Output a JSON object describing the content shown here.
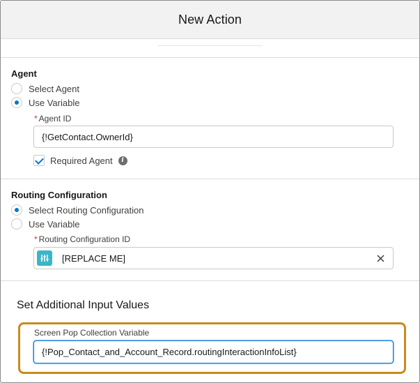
{
  "header": {
    "title": "New Action"
  },
  "agent": {
    "section_title": "Agent",
    "options": [
      {
        "label": "Select Agent",
        "checked": false
      },
      {
        "label": "Use Variable",
        "checked": true
      }
    ],
    "agent_id": {
      "required_marker": "*",
      "label": "Agent ID",
      "value": "{!GetContact.OwnerId}"
    },
    "required_agent": {
      "label": "Required Agent",
      "checked": true,
      "info_icon": "info-icon"
    }
  },
  "routing": {
    "section_title": "Routing Configuration",
    "options": [
      {
        "label": "Select Routing Configuration",
        "checked": true
      },
      {
        "label": "Use Variable",
        "checked": false
      }
    ],
    "routing_config_id": {
      "required_marker": "*",
      "label": "Routing Configuration ID",
      "value": "[REPLACE ME]",
      "icon": "routing-configuration-icon",
      "clear_icon": "close-icon"
    }
  },
  "additional": {
    "title": "Set Additional Input Values",
    "screen_pop": {
      "label": "Screen Pop Collection Variable",
      "value": "{!Pop_Contact_and_Account_Record.routingInteractionInfoList}"
    }
  },
  "colors": {
    "accent": "#0176d3",
    "required": "#c23934",
    "highlight_border": "#c88a1e",
    "routing_icon_bg": "#3bb5c8"
  }
}
